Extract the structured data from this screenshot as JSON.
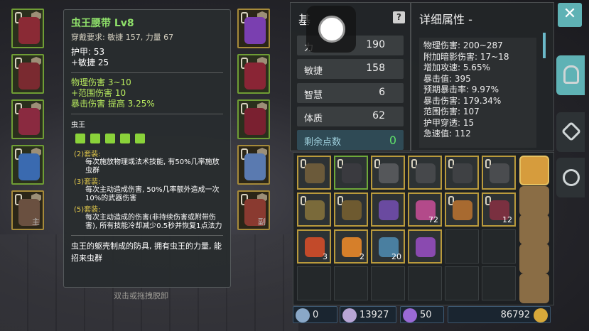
{
  "tooltip": {
    "title": "虫王腰带 Lv8",
    "requirement": "穿戴要求:   敏捷 157, 力量 67",
    "armor": "护甲:   53",
    "agility": "+敏捷 25",
    "phys_damage": "物理伤害 3~10",
    "range_damage": "+范围伤害 10",
    "crit_damage": "暴击伤害 提高 3.25%",
    "set_name": "虫王",
    "set_bonuses": [
      {
        "head": "(2)套装:",
        "desc": "每次施放物理或法术技能, 有50%几率施放虫群"
      },
      {
        "head": "(3)套装:",
        "desc": "每次主动造成伤害, 50%几率额外造成一次10%的武器伤害"
      },
      {
        "head": "(5)套装:",
        "desc": "每次主动造成的伤害(非持续伤害或附带伤害), 所有技能冷却减少0.5秒并恢复1点法力"
      }
    ],
    "description": "虫王的躯壳制成的防具, 拥有虫王的力量, 能招来虫群",
    "unequip_hint": "双击或拖拽脱卸"
  },
  "equipment": {
    "left": [
      {
        "tag": ""
      },
      {
        "tag": ""
      },
      {
        "tag": ""
      },
      {
        "tag": ""
      },
      {
        "tag": "主"
      }
    ],
    "right": [
      {
        "tag": ""
      },
      {
        "tag": ""
      },
      {
        "tag": ""
      },
      {
        "tag": ""
      },
      {
        "tag": "副"
      }
    ]
  },
  "stats": {
    "title_fragment": "基",
    "rows": [
      {
        "label": "力",
        "value": "190"
      },
      {
        "label": "敏捷",
        "value": "158"
      },
      {
        "label": "智慧",
        "value": "6"
      },
      {
        "label": "体质",
        "value": "62"
      }
    ],
    "points_label": "剩余点数",
    "points_value": "0"
  },
  "detail": {
    "title": "详细属性 -",
    "lines": [
      "物理伤害: 200~287",
      "附加暗影伤害: 17~18",
      "增加攻速: 5.65%",
      "暴击值: 395",
      "预期暴击率: 9.97%",
      "暴击伤害: 179.34%",
      "范围伤害: 107",
      "护甲穿透: 15",
      "急速值: 112"
    ]
  },
  "inventory": {
    "cells": [
      {
        "color": "#6b5a3a",
        "count": "",
        "border": "gold",
        "chain": true
      },
      {
        "color": "#3a3a3f",
        "count": "",
        "border": "green",
        "chain": true
      },
      {
        "color": "#55575a",
        "count": "",
        "border": "gold",
        "chain": true
      },
      {
        "color": "#46484b",
        "count": "",
        "border": "gold",
        "chain": true
      },
      {
        "color": "#3f4144",
        "count": "",
        "border": "gold",
        "chain": true
      },
      {
        "color": "#4a4c4f",
        "count": "",
        "border": "gold",
        "chain": true
      },
      {
        "color": "#7a6a3a",
        "count": "",
        "border": "gold",
        "chain": true
      },
      {
        "color": "#6e5a30",
        "count": "",
        "border": "gold",
        "chain": true
      },
      {
        "color": "#6a4aa0",
        "count": "",
        "border": "gold",
        "chain": false
      },
      {
        "color": "#b34a8a",
        "count": "72",
        "border": "gold",
        "chain": false
      },
      {
        "color": "#a86a30",
        "count": "",
        "border": "gold",
        "chain": true
      },
      {
        "color": "#7a3040",
        "count": "12",
        "border": "gold",
        "chain": true
      },
      {
        "color": "#c24a2a",
        "count": "3",
        "border": "gold",
        "chain": false
      },
      {
        "color": "#d67f2a",
        "count": "2",
        "border": "gold",
        "chain": false
      },
      {
        "color": "#4a7fa0",
        "count": "20",
        "border": "gold",
        "chain": false
      },
      {
        "color": "#8a4ab0",
        "count": "",
        "border": "gold",
        "chain": false
      }
    ]
  },
  "currency": [
    {
      "value": "0",
      "color": "#8aa8c8"
    },
    {
      "value": "13927",
      "color": "#b8a6d6"
    },
    {
      "value": "50",
      "color": "#9a6ad6"
    },
    {
      "value": "86792",
      "color": "#d6a83a"
    }
  ],
  "close_label": "✕"
}
